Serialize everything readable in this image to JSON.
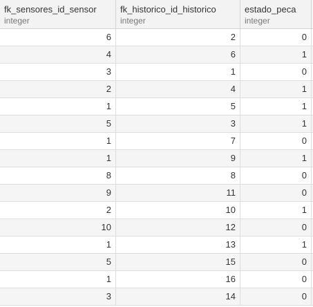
{
  "columns": [
    {
      "name": "fk_sensores_id_sensor",
      "type": "integer"
    },
    {
      "name": "fk_historico_id_historico",
      "type": "integer"
    },
    {
      "name": "estado_peca",
      "type": "integer"
    }
  ],
  "rows": [
    [
      "6",
      "2",
      "0"
    ],
    [
      "4",
      "6",
      "1"
    ],
    [
      "3",
      "1",
      "0"
    ],
    [
      "2",
      "4",
      "1"
    ],
    [
      "1",
      "5",
      "1"
    ],
    [
      "5",
      "3",
      "1"
    ],
    [
      "1",
      "7",
      "0"
    ],
    [
      "1",
      "9",
      "1"
    ],
    [
      "8",
      "8",
      "0"
    ],
    [
      "9",
      "11",
      "0"
    ],
    [
      "2",
      "10",
      "1"
    ],
    [
      "10",
      "12",
      "0"
    ],
    [
      "1",
      "13",
      "1"
    ],
    [
      "5",
      "15",
      "0"
    ],
    [
      "1",
      "16",
      "0"
    ],
    [
      "3",
      "14",
      "0"
    ]
  ],
  "colors": {
    "header_bg": "#f3f3f3",
    "row_alt_bg": "#f5f5f5",
    "border": "#dddddd",
    "type_text": "#777777"
  }
}
